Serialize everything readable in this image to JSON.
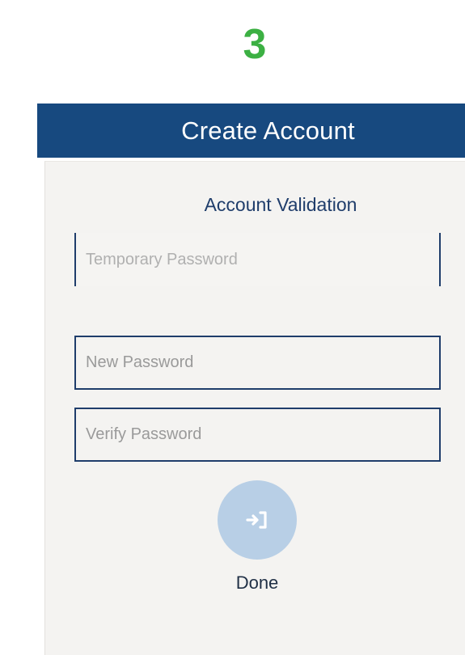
{
  "step": {
    "number": "3"
  },
  "header": {
    "title": "Create Account"
  },
  "form": {
    "section_title": "Account Validation",
    "temporary_password": {
      "placeholder": "Temporary Password",
      "value": ""
    },
    "new_password": {
      "placeholder": "New Password",
      "value": ""
    },
    "verify_password": {
      "placeholder": "Verify Password",
      "value": ""
    },
    "done_label": "Done",
    "done_icon": "sign-in-icon"
  },
  "colors": {
    "step_number": "#3cb043",
    "header_bg": "#17497f",
    "panel_bg": "#f4f3f1",
    "field_border": "#1f3d6b",
    "done_button_bg": "#b8cfe6"
  }
}
